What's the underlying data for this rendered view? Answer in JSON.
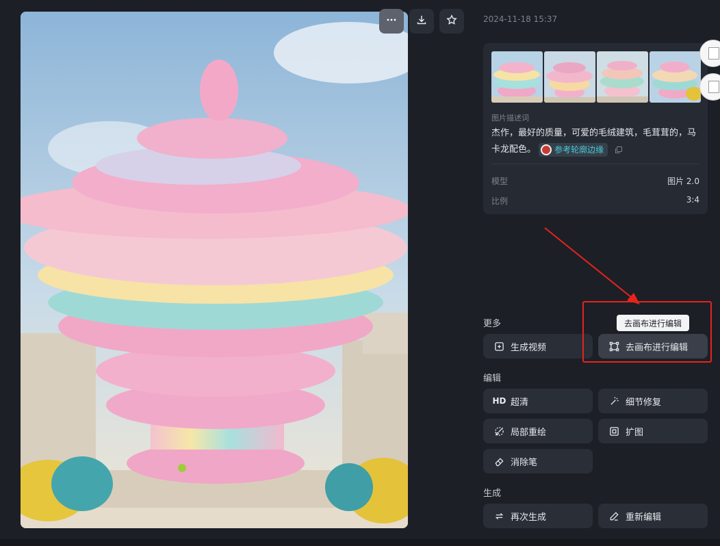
{
  "toolbar": {
    "more_icon": "ellipsis-icon",
    "download_icon": "download-icon",
    "favorite_icon": "star-icon"
  },
  "timestamp": "2024-11-18 15:37",
  "info": {
    "description_label": "图片描述词",
    "description_text": "杰作，最好的质量，可爱的毛绒建筑，毛茸茸的，马卡龙配色。",
    "reference_label": "参考轮廓边缘",
    "model_label": "模型",
    "model_value": "图片 2.0",
    "ratio_label": "比例",
    "ratio_value": "3:4"
  },
  "sections": {
    "more": "更多",
    "edit": "编辑",
    "generate": "生成"
  },
  "buttons": {
    "generate_video": "生成视频",
    "canvas_edit": "去画布进行编辑",
    "hd_icon_text": "HD",
    "super_res": "超清",
    "detail_fix": "细节修复",
    "inpaint": "局部重绘",
    "outpaint": "扩图",
    "eraser": "消除笔",
    "regenerate": "再次生成",
    "re_edit": "重新编辑"
  },
  "tooltip": "去画布进行编辑",
  "colors": {
    "background": "#1c1f26",
    "panel": "#262a33",
    "button": "#2a2e37",
    "accent": "#4cc7d9",
    "annotation": "#e8231c"
  }
}
